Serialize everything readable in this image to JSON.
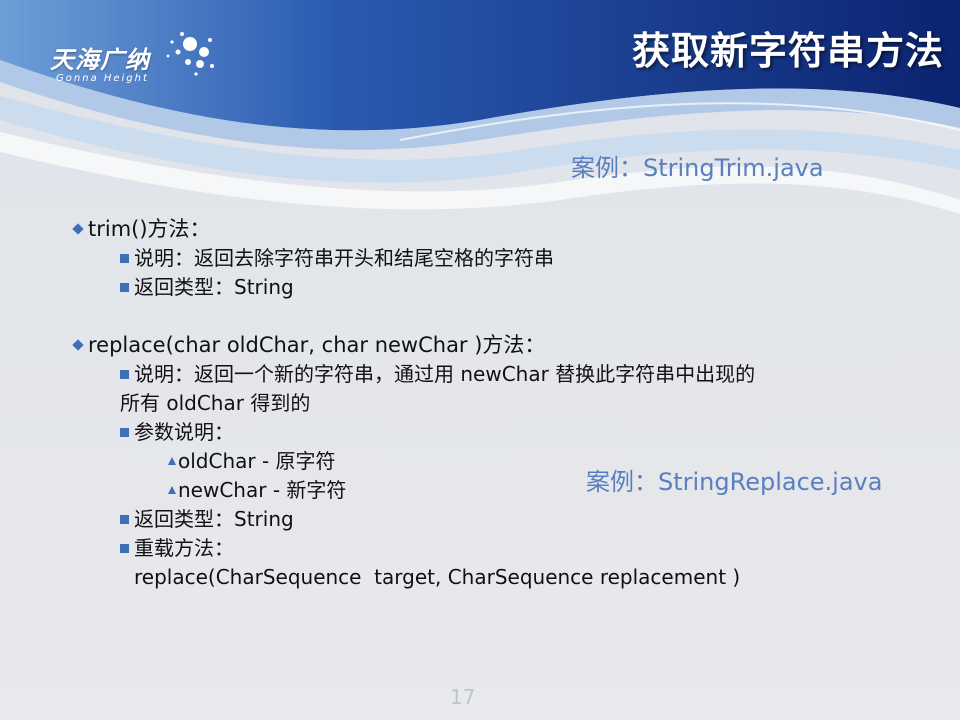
{
  "logo": {
    "cn": "天海广纳",
    "en": "Gonna Height"
  },
  "title": "获取新字符串方法",
  "case_trim": "案例：StringTrim.java",
  "case_replace": "案例：StringReplace.java",
  "trim": {
    "heading": "trim()方法：",
    "desc": "说明：返回去除字符串开头和结尾空格的字符串",
    "ret": "返回类型：String"
  },
  "replace": {
    "heading": "replace(char oldChar, char newChar )方法：",
    "desc_line1": "说明：返回一个新的字符串，通过用 newChar 替换此字符串中出现的",
    "desc_line2": "所有 oldChar 得到的",
    "params_label": "参数说明：",
    "param1": "oldChar - 原字符",
    "param2": "newChar - 新字符",
    "ret": "返回类型：String",
    "overload_label": "重载方法：",
    "overload_sig": "replace(CharSequence  target, CharSequence replacement )"
  },
  "page_number": "17",
  "colors": {
    "accent": "#3e6fb8",
    "case_text": "#5a7fc0",
    "header_dark": "#0d2a78"
  }
}
